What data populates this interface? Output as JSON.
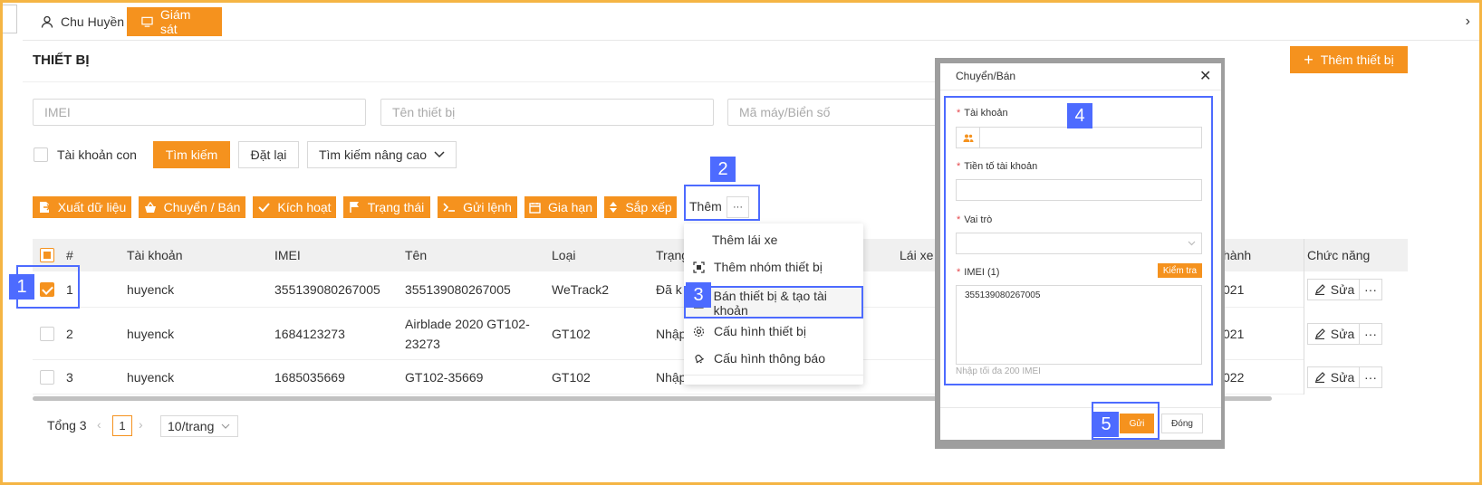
{
  "tabs": [
    {
      "label": "Chu Huyền",
      "icon": "user-icon"
    },
    {
      "label": "Giám sát",
      "icon": "monitor-icon"
    }
  ],
  "page_title": "THIẾT BỊ",
  "add_device_label": "Thêm thiết bị",
  "filters": {
    "imei_placeholder": "IMEI",
    "name_placeholder": "Tên thiết bị",
    "plate_placeholder": "Mã máy/Biển số"
  },
  "subaccount_label": "Tài khoản con",
  "search_label": "Tìm kiếm",
  "reset_label": "Đặt lại",
  "advanced_label": "Tìm kiếm nâng cao",
  "toolbar": [
    {
      "label": "Xuất dữ liệu",
      "icon": "export-icon"
    },
    {
      "label": "Chuyển / Bán",
      "icon": "basket-icon"
    },
    {
      "label": "Kích hoạt",
      "icon": "activate-icon"
    },
    {
      "label": "Trạng thái",
      "icon": "flag-icon"
    },
    {
      "label": "Gửi lệnh",
      "icon": "terminal-icon"
    },
    {
      "label": "Gia hạn",
      "icon": "calendar-icon"
    },
    {
      "label": "Sắp xếp",
      "icon": "sort-icon"
    }
  ],
  "more_label": "Thêm",
  "more_dots": "···",
  "dropdown": [
    {
      "label": "Thêm lái xe",
      "icon": ""
    },
    {
      "label": "Thêm nhóm thiết bị",
      "icon": "group-icon"
    },
    {
      "label": "Bán thiết bị & tạo tài khoản",
      "icon": "sell-icon"
    },
    {
      "label": "Cấu hình thiết bị",
      "icon": "gear-icon"
    },
    {
      "label": "Cấu hình thông báo",
      "icon": "bell-icon"
    }
  ],
  "table": {
    "headers": {
      "num": "#",
      "account": "Tài khoản",
      "imei": "IMEI",
      "name": "Tên",
      "type": "Loại",
      "status": "Trạng",
      "driver": "Lái xe",
      "expire": "hành",
      "actions": "Chức năng"
    },
    "rows": [
      {
        "num": "1",
        "account": "huyenck",
        "imei": "355139080267005",
        "name": "355139080267005",
        "type": "WeTrack2",
        "status": "Đã k",
        "expire": "021",
        "checked": true
      },
      {
        "num": "2",
        "account": "huyenck",
        "imei": "1684123273",
        "name": "Airblade 2020 GT102-23273",
        "type": "GT102",
        "status": "Nhập",
        "expire": "021",
        "checked": false
      },
      {
        "num": "3",
        "account": "huyenck",
        "imei": "1685035669",
        "name": "GT102-35669",
        "type": "GT102",
        "status": "Nhập",
        "expire": "022",
        "checked": false
      }
    ],
    "edit_label": "Sửa"
  },
  "pagination": {
    "total": "Tổng 3",
    "page": "1",
    "per_page": "10/trang"
  },
  "modal": {
    "title": "Chuyển/Bán",
    "account_label": "Tài khoản",
    "prefix_label": "Tiền tố tài khoản",
    "role_label": "Vai trò",
    "imei_label": "IMEI (1)",
    "check_label": "Kiểm tra",
    "imei_value": "355139080267005",
    "hint": "Nhập tối đa 200 IMEI",
    "send_label": "Gửi",
    "close_label": "Đóng"
  },
  "callouts": [
    "1",
    "2",
    "3",
    "4",
    "5"
  ],
  "colors": {
    "accent": "#f5921e",
    "callout": "#4d6bff"
  }
}
